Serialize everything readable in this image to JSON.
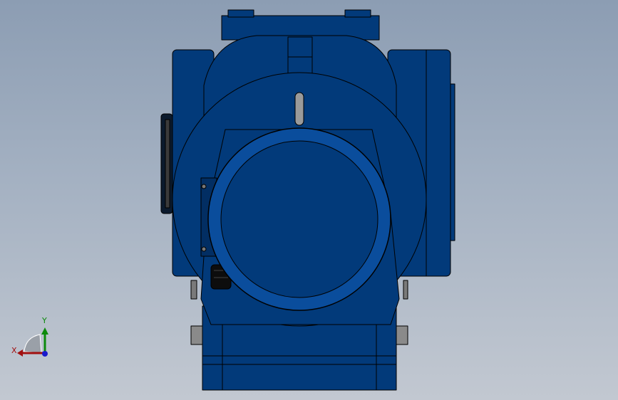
{
  "viewport": {
    "background_top": "#8c9db3",
    "background_bottom": "#c2c8d1"
  },
  "model": {
    "part": "gear-motor",
    "view": "front",
    "body_color": "#023a7a",
    "body_shade": "#022e63",
    "body_highlight": "#0a4d9c",
    "edge_color": "#000000",
    "metal_color": "#9a9a9a"
  },
  "triad": {
    "x_label": "X",
    "y_label": "Y",
    "x_color": "#a10f0f",
    "y_color": "#0c8a0c",
    "z_color": "#1a1acc"
  }
}
